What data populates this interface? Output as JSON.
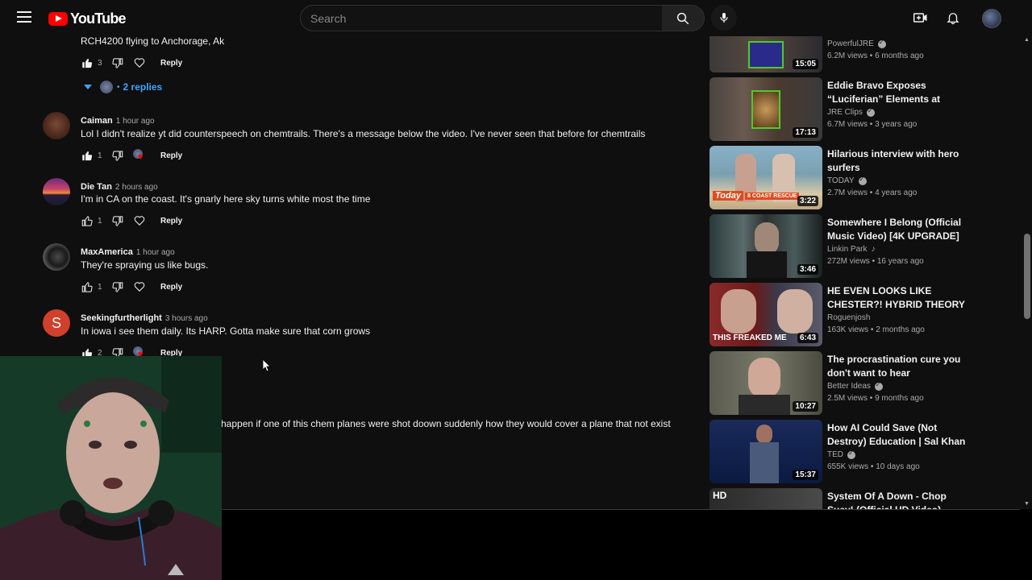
{
  "header": {
    "logo_text": "YouTube",
    "search_placeholder": "Search"
  },
  "thread_top": {
    "text": "RCH4200 flying to Anchorage, Ak",
    "likes": "3",
    "reply_label": "Reply",
    "replies_label": "2 replies"
  },
  "comments": [
    {
      "author": "Caiman",
      "time": "1 hour ago",
      "text": "Lol I didn't realize yt did counterspeech on chemtrails. There's a message below the video. I've never seen that before for chemtrails",
      "likes": "1",
      "reply_label": "Reply",
      "liked": true,
      "creator_heart": true
    },
    {
      "author": "Die Tan",
      "time": "2 hours ago",
      "text": "I'm in CA on the coast. It's gnarly here sky turns white most the time",
      "likes": "1",
      "reply_label": "Reply",
      "liked": false,
      "creator_heart": false
    },
    {
      "author": "MaxAmerica",
      "time": "1 hour ago",
      "text": "They're spraying us like bugs.",
      "likes": "1",
      "reply_label": "Reply",
      "liked": false,
      "creator_heart": false
    },
    {
      "author": "Seekingfurtherlight",
      "time": "3 hours ago",
      "text": "In iowa i see them daily. Its HARP. Gotta make sure that corn grows",
      "likes": "2",
      "reply_label": "Reply",
      "liked": true,
      "creator_heart": true,
      "avatar_letter": "S"
    }
  ],
  "partial_comment": {
    "text": "happen  if one of this chem planes were shot doown suddenly  how they would cover  a plane that not exist"
  },
  "sidebar": {
    "videos": [
      {
        "title": "",
        "channel": "PowerfulJRE",
        "verified": true,
        "views": "6.2M views",
        "age": "6 months ago",
        "duration": "15:05"
      },
      {
        "title": "Eddie Bravo Exposes “Luciferian” Elements at Vatican",
        "channel": "JRE Clips",
        "verified": true,
        "views": "6.7M views",
        "age": "3 years ago",
        "duration": "17:13"
      },
      {
        "title": "Hilarious interview with hero surfers",
        "channel": "TODAY",
        "verified": true,
        "views": "2.7M views",
        "age": "4 years ago",
        "duration": "3:22",
        "thumb_text": "Today",
        "thumb_banner": "8 COAST RESCUE"
      },
      {
        "title": "Somewhere I Belong (Official Music Video) [4K UPGRADE] –...",
        "channel": "Linkin Park",
        "verified": false,
        "music": true,
        "views": "272M views",
        "age": "16 years ago",
        "duration": "3:46"
      },
      {
        "title": "HE EVEN LOOKS LIKE CHESTER?! HYBRID THEORY -...",
        "channel": "Roguenjosh",
        "verified": false,
        "views": "163K views",
        "age": "2 months ago",
        "duration": "6:43",
        "thumb_text": "THIS FREAKED ME"
      },
      {
        "title": "The procrastination cure you don't want to hear",
        "channel": "Better Ideas",
        "verified": true,
        "views": "2.5M views",
        "age": "9 months ago",
        "duration": "10:27"
      },
      {
        "title": "How AI Could Save (Not Destroy) Education | Sal Khan |...",
        "channel": "TED",
        "verified": true,
        "views": "655K views",
        "age": "10 days ago",
        "duration": "15:37"
      },
      {
        "title": "System Of A Down - Chop Suey! (Official HD Video)",
        "channel": "",
        "verified": false,
        "views": "",
        "age": "",
        "duration": "",
        "thumb_text": "HD"
      }
    ]
  },
  "colors": {
    "background": "#0f0f0f",
    "accent_blue": "#3ea6ff",
    "brand_red": "#ff0000",
    "text_primary": "#f1f1f1",
    "text_secondary": "#aaaaaa"
  }
}
